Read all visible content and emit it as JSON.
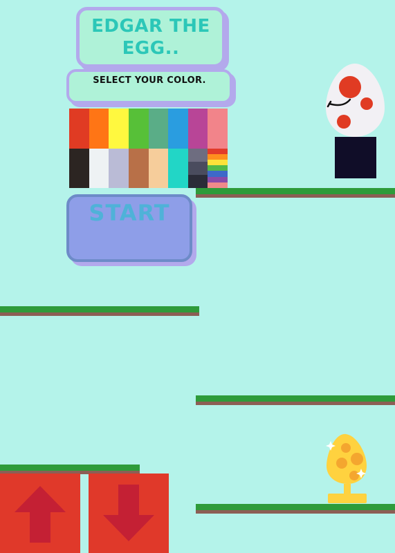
{
  "title": {
    "line1": "EDGAR THE",
    "line2": "EGG.."
  },
  "subtitle": "SELECT YOUR COLOR.",
  "start_label": "START",
  "palette": {
    "row1": [
      "#e03b23",
      "#ff7515",
      "#fff83f",
      "#57c038",
      "#5aad87",
      "#2a9de0",
      "#b84597",
      "#f2848a"
    ],
    "row2": [
      "#2c2522",
      "#eef2f4",
      "#babbd6",
      "#b87048",
      "#f6cd9b",
      "#22d6c6",
      "multi-gray",
      "rainbow"
    ],
    "multi_gray": [
      "#6e6d80",
      "#4a4c5e",
      "#2b2c38"
    ],
    "rainbow": [
      "#e23b2a",
      "#ff8f1e",
      "#fce23a",
      "#52b94a",
      "#3d69c9",
      "#8a4aa8",
      "#f08a8a"
    ]
  },
  "colors": {
    "background": "#b4f3ea",
    "panel": "#aff2d8",
    "panel_border": "#b3a9ec",
    "title_text": "#2cc7b8",
    "start_button": "#8e9ee8",
    "start_text": "#4fb2d8",
    "grass": "#2e9b3a",
    "dirt": "#8c5e55",
    "arrow_button": "#e0392a",
    "arrow_icon": "#c42034",
    "trophy": "#ffd23f"
  },
  "icons": [
    "up-arrow-icon",
    "down-arrow-icon",
    "trophy-egg-icon",
    "egg-character-icon"
  ]
}
